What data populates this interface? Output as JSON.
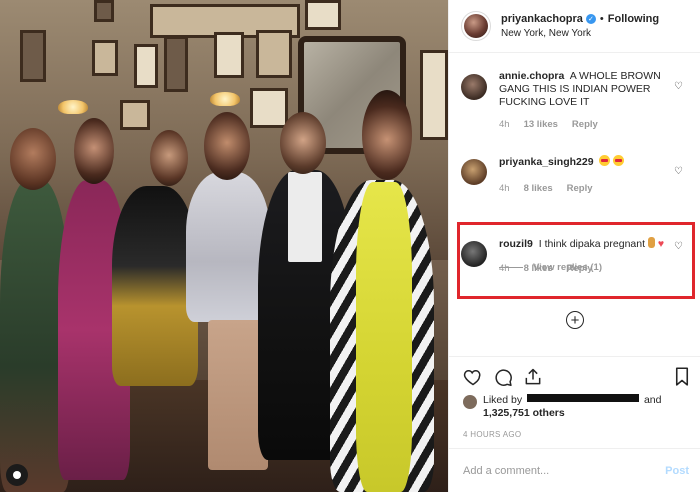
{
  "header": {
    "username": "priyankachopra",
    "separator": "•",
    "follow_status": "Following",
    "location": "New York, New York"
  },
  "comments": [
    {
      "user": "annie.chopra",
      "text": "A WHOLE BROWN GANG THIS IS INDIAN POWER FUCKING LOVE IT",
      "time": "4h",
      "likes": "13 likes",
      "reply": "Reply"
    },
    {
      "user": "priyanka_singh229",
      "text": "",
      "time": "4h",
      "likes": "8 likes",
      "reply": "Reply"
    },
    {
      "user": "rouzil9",
      "text": "I think dipaka pregnant",
      "time": "4h",
      "likes": "8 likes",
      "reply": "Reply"
    }
  ],
  "view_replies": "View replies (1)",
  "likes": {
    "prefix": "Liked by",
    "suffix": "and",
    "count": "1,325,751 others"
  },
  "timestamp": "4 HOURS AGO",
  "add_comment": {
    "placeholder": "Add a comment...",
    "post_label": "Post"
  },
  "colors": {
    "highlight": "#e0262c",
    "verified": "#3897f0",
    "post_disabled": "#b3dbff"
  },
  "icons": [
    "heart-icon",
    "comment-icon",
    "share-icon",
    "bookmark-icon",
    "add-icon"
  ]
}
